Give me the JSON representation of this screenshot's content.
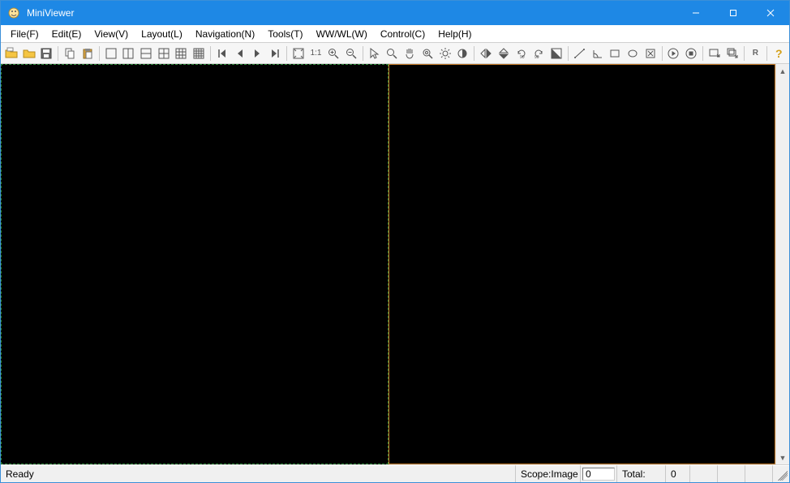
{
  "titlebar": {
    "title": "MiniViewer"
  },
  "menubar": {
    "items": [
      {
        "label": "File(F)"
      },
      {
        "label": "Edit(E)"
      },
      {
        "label": "View(V)"
      },
      {
        "label": "Layout(L)"
      },
      {
        "label": "Navigation(N)"
      },
      {
        "label": "Tools(T)"
      },
      {
        "label": "WW/WL(W)"
      },
      {
        "label": "Control(C)"
      },
      {
        "label": "Help(H)"
      }
    ]
  },
  "toolbar": {
    "one_to_one": "1:1",
    "reset_label": "R"
  },
  "statusbar": {
    "ready": "Ready",
    "scope_label": "Scope:Image",
    "scope_value": "0",
    "total_label": "Total:",
    "total_value": "0"
  }
}
